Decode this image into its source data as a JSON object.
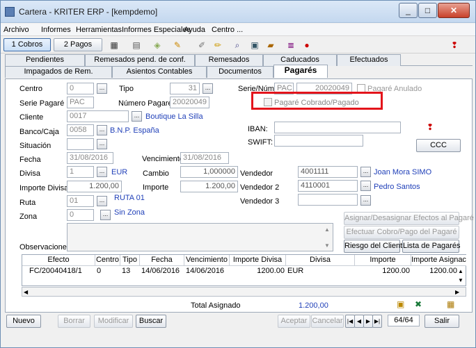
{
  "window": {
    "title": "Cartera - KRITER ERP - [kempdemo]"
  },
  "menu": [
    "Archivo",
    "Informes",
    "Herramientas",
    "Informes Especiales",
    "Ayuda",
    "Centro ..."
  ],
  "toolbar": {
    "cobros": "1 Cobros",
    "pagos": "2 Pagos"
  },
  "tabs_top": [
    "Pendientes",
    "Remesados pend. de conf.",
    "Remesados",
    "Caducados",
    "Efectuados"
  ],
  "tabs_bottom": [
    "Impagados de Rem.",
    "Asientos Contables",
    "Documentos",
    "Pagarés"
  ],
  "form": {
    "centro_label": "Centro",
    "centro_value": "0",
    "tipo_label": "Tipo",
    "tipo_value": "31",
    "serienum_label": "Serie/Núm",
    "serie_value": "PAC",
    "num_value": "20020049",
    "anulado_label": "Pagaré Anulado",
    "serie_pagare_label": "Serie Pagaré",
    "serie_pagare_value": "PAC",
    "numero_pagare_label": "Número Pagaré",
    "numero_pagare_value": "20020049",
    "cobrado_label": "Pagaré Cobrado/Pagado",
    "cliente_label": "Cliente",
    "cliente_value": "0017",
    "cliente_name": "Boutique La Silla",
    "banco_label": "Banco/Caja",
    "banco_value": "0058",
    "banco_name": "B.N.P. España",
    "iban_label": "IBAN:",
    "swift_label": "SWIFT:",
    "situacion_label": "Situación",
    "ccc_button": "CCC",
    "fecha_label": "Fecha",
    "fecha_value": "31/08/2016",
    "vencimiento_label": "Vencimiento",
    "vencimiento_value": "31/08/2016",
    "divisa_label": "Divisa",
    "divisa_value": "1",
    "divisa_name": "EUR",
    "cambio_label": "Cambio",
    "cambio_value": "1,000000",
    "vendedor_label": "Vendedor",
    "vendedor_value": "4001111",
    "vendedor_name": "Joan Mora SIMO",
    "importe_divisa_label": "Importe Divisa",
    "importe_divisa_value": "1.200,00",
    "importe_label": "Importe",
    "importe_value": "1.200,00",
    "vendedor2_label": "Vendedor 2",
    "vendedor2_value": "4110001",
    "vendedor2_name": "Pedro Santos",
    "ruta_label": "Ruta",
    "ruta_value": "01",
    "ruta_name": "RUTA 01",
    "vendedor3_label": "Vendedor 3",
    "zona_label": "Zona",
    "zona_value": "0",
    "zona_name": "Sin Zona",
    "observaciones_label": "Observaciones"
  },
  "actions": {
    "asignar": "Asignar/Desasignar Efectos al Pagaré",
    "efectuar": "Efectuar Cobro/Pago del Pagaré",
    "riesgo": "Riesgo del Cliente",
    "lista": "Lista de Pagarés"
  },
  "grid": {
    "headers": [
      "Efecto",
      "Centro",
      "Tipo",
      "Fecha",
      "Vencimiento",
      "Importe Divisa",
      "Divisa",
      "Importe",
      "Importe Asignac"
    ],
    "rows": [
      [
        "FC/20040418/1",
        "0",
        "13",
        "14/06/2016",
        "14/06/2016",
        "1200.00",
        "EUR",
        "1200.00",
        "1200.00"
      ]
    ]
  },
  "totals": {
    "label": "Total Asignado",
    "value": "1.200,00"
  },
  "footer": {
    "nuevo": "Nuevo",
    "borrar": "Borrar",
    "modificar": "Modificar",
    "buscar": "Buscar",
    "aceptar": "Aceptar",
    "cancelar": "Cancelar",
    "record": "64/64",
    "salir": "Salir"
  },
  "colors": {
    "link": "#1f3fb8",
    "highlight": "#e3141b"
  }
}
